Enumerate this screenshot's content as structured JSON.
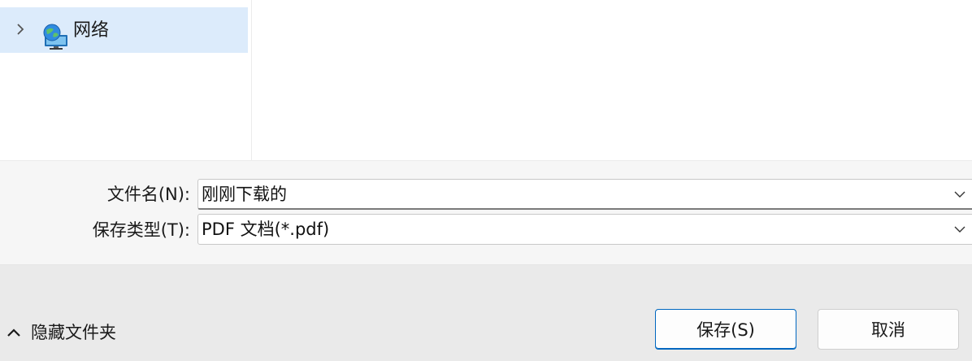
{
  "nav": {
    "items": [
      {
        "label": "网络",
        "icon": "network-icon",
        "selected": true
      }
    ]
  },
  "form": {
    "filename_label": "文件名(N):",
    "filename_value": "刚刚下载的",
    "filetype_label": "保存类型(T):",
    "filetype_value": "PDF 文档(*.pdf)"
  },
  "footer": {
    "hide_folders_label": "隐藏文件夹",
    "save_label": "保存(S)",
    "cancel_label": "取消"
  },
  "colors": {
    "selection": "#dcebfb",
    "accent": "#0067c0",
    "form_background": "#f6f6f6",
    "footer_background": "#eaeaea"
  }
}
